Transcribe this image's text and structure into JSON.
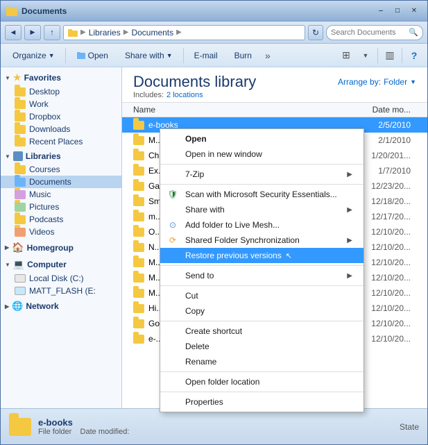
{
  "window": {
    "title": "Documents",
    "titlebar_label": "Documents"
  },
  "addressbar": {
    "path": [
      "Libraries",
      "Documents"
    ],
    "search_placeholder": "Search Documents",
    "refresh_symbol": "↻"
  },
  "toolbar": {
    "organize_label": "Organize",
    "open_label": "Open",
    "share_with_label": "Share with",
    "email_label": "E-mail",
    "burn_label": "Burn",
    "more_symbol": "»"
  },
  "sidebar": {
    "favorites_label": "Favorites",
    "favorites_items": [
      {
        "name": "Desktop",
        "type": "folder"
      },
      {
        "name": "Work",
        "type": "folder"
      },
      {
        "name": "Dropbox",
        "type": "folder"
      },
      {
        "name": "Downloads",
        "type": "folder"
      },
      {
        "name": "Recent Places",
        "type": "folder"
      }
    ],
    "libraries_label": "Libraries",
    "libraries_items": [
      {
        "name": "Courses",
        "type": "folder"
      },
      {
        "name": "Documents",
        "type": "docfolder",
        "selected": true
      },
      {
        "name": "Music",
        "type": "folder"
      },
      {
        "name": "Pictures",
        "type": "folder"
      },
      {
        "name": "Podcasts",
        "type": "folder"
      },
      {
        "name": "Videos",
        "type": "folder"
      }
    ],
    "homegroup_label": "Homegroup",
    "computer_label": "Computer",
    "computer_items": [
      {
        "name": "Local Disk (C:)",
        "type": "hdd"
      },
      {
        "name": "MATT_FLASH (E:)",
        "type": "hdd"
      }
    ],
    "network_label": "Network"
  },
  "library": {
    "title": "Documents library",
    "includes_label": "Includes:",
    "locations_label": "2 locations",
    "arrange_label": "Arrange by:",
    "arrange_value": "Folder"
  },
  "columns": {
    "name_label": "Name",
    "date_label": "Date mo..."
  },
  "files": [
    {
      "name": "e-books",
      "date": "2/5/2010",
      "selected": true,
      "highlighted": true
    },
    {
      "name": "M...",
      "date": "2/1/2010"
    },
    {
      "name": "Ch...",
      "date": "1/20/201..."
    },
    {
      "name": "Ex...",
      "date": "1/7/2010"
    },
    {
      "name": "Ga...",
      "date": "12/23/20..."
    },
    {
      "name": "Sm...",
      "date": "12/18/20..."
    },
    {
      "name": "m...",
      "date": "12/17/20..."
    },
    {
      "name": "O...",
      "date": "12/10/20..."
    },
    {
      "name": "N...",
      "date": "12/10/20..."
    },
    {
      "name": "M...",
      "date": "12/10/20..."
    },
    {
      "name": "M...",
      "date": "12/10/20..."
    },
    {
      "name": "M...",
      "date": "12/10/20..."
    },
    {
      "name": "Hi...",
      "date": "12/10/20..."
    },
    {
      "name": "Go...",
      "date": "12/10/20..."
    },
    {
      "name": "e-...",
      "date": "12/10/20..."
    }
  ],
  "context_menu": {
    "items": [
      {
        "label": "Open",
        "type": "item",
        "bold": true
      },
      {
        "label": "Open in new window",
        "type": "item"
      },
      {
        "label": "7-Zip",
        "type": "item",
        "has_arrow": true
      },
      {
        "label": "Scan with Microsoft Security Essentials...",
        "type": "item",
        "has_icon": "shield"
      },
      {
        "label": "Share with",
        "type": "item",
        "has_arrow": true
      },
      {
        "label": "Add folder to Live Mesh...",
        "type": "item",
        "has_icon": "mesh"
      },
      {
        "label": "Shared Folder Synchronization",
        "type": "item",
        "has_arrow": true,
        "has_icon": "sync"
      },
      {
        "label": "Restore previous versions",
        "type": "item",
        "highlighted": true
      },
      {
        "label": "Send to",
        "type": "item",
        "has_arrow": true
      },
      {
        "label": "Cut",
        "type": "item"
      },
      {
        "label": "Copy",
        "type": "item"
      },
      {
        "label": "Create shortcut",
        "type": "item"
      },
      {
        "label": "Delete",
        "type": "item"
      },
      {
        "label": "Rename",
        "type": "item"
      },
      {
        "label": "Open folder location",
        "type": "item"
      },
      {
        "label": "Properties",
        "type": "item"
      }
    ],
    "separators_after": [
      1,
      2,
      7,
      9,
      11,
      14
    ]
  },
  "statusbar": {
    "folder_name": "e-books",
    "folder_type": "File folder",
    "folder_detail": "Date modified:",
    "state_label": "State"
  }
}
